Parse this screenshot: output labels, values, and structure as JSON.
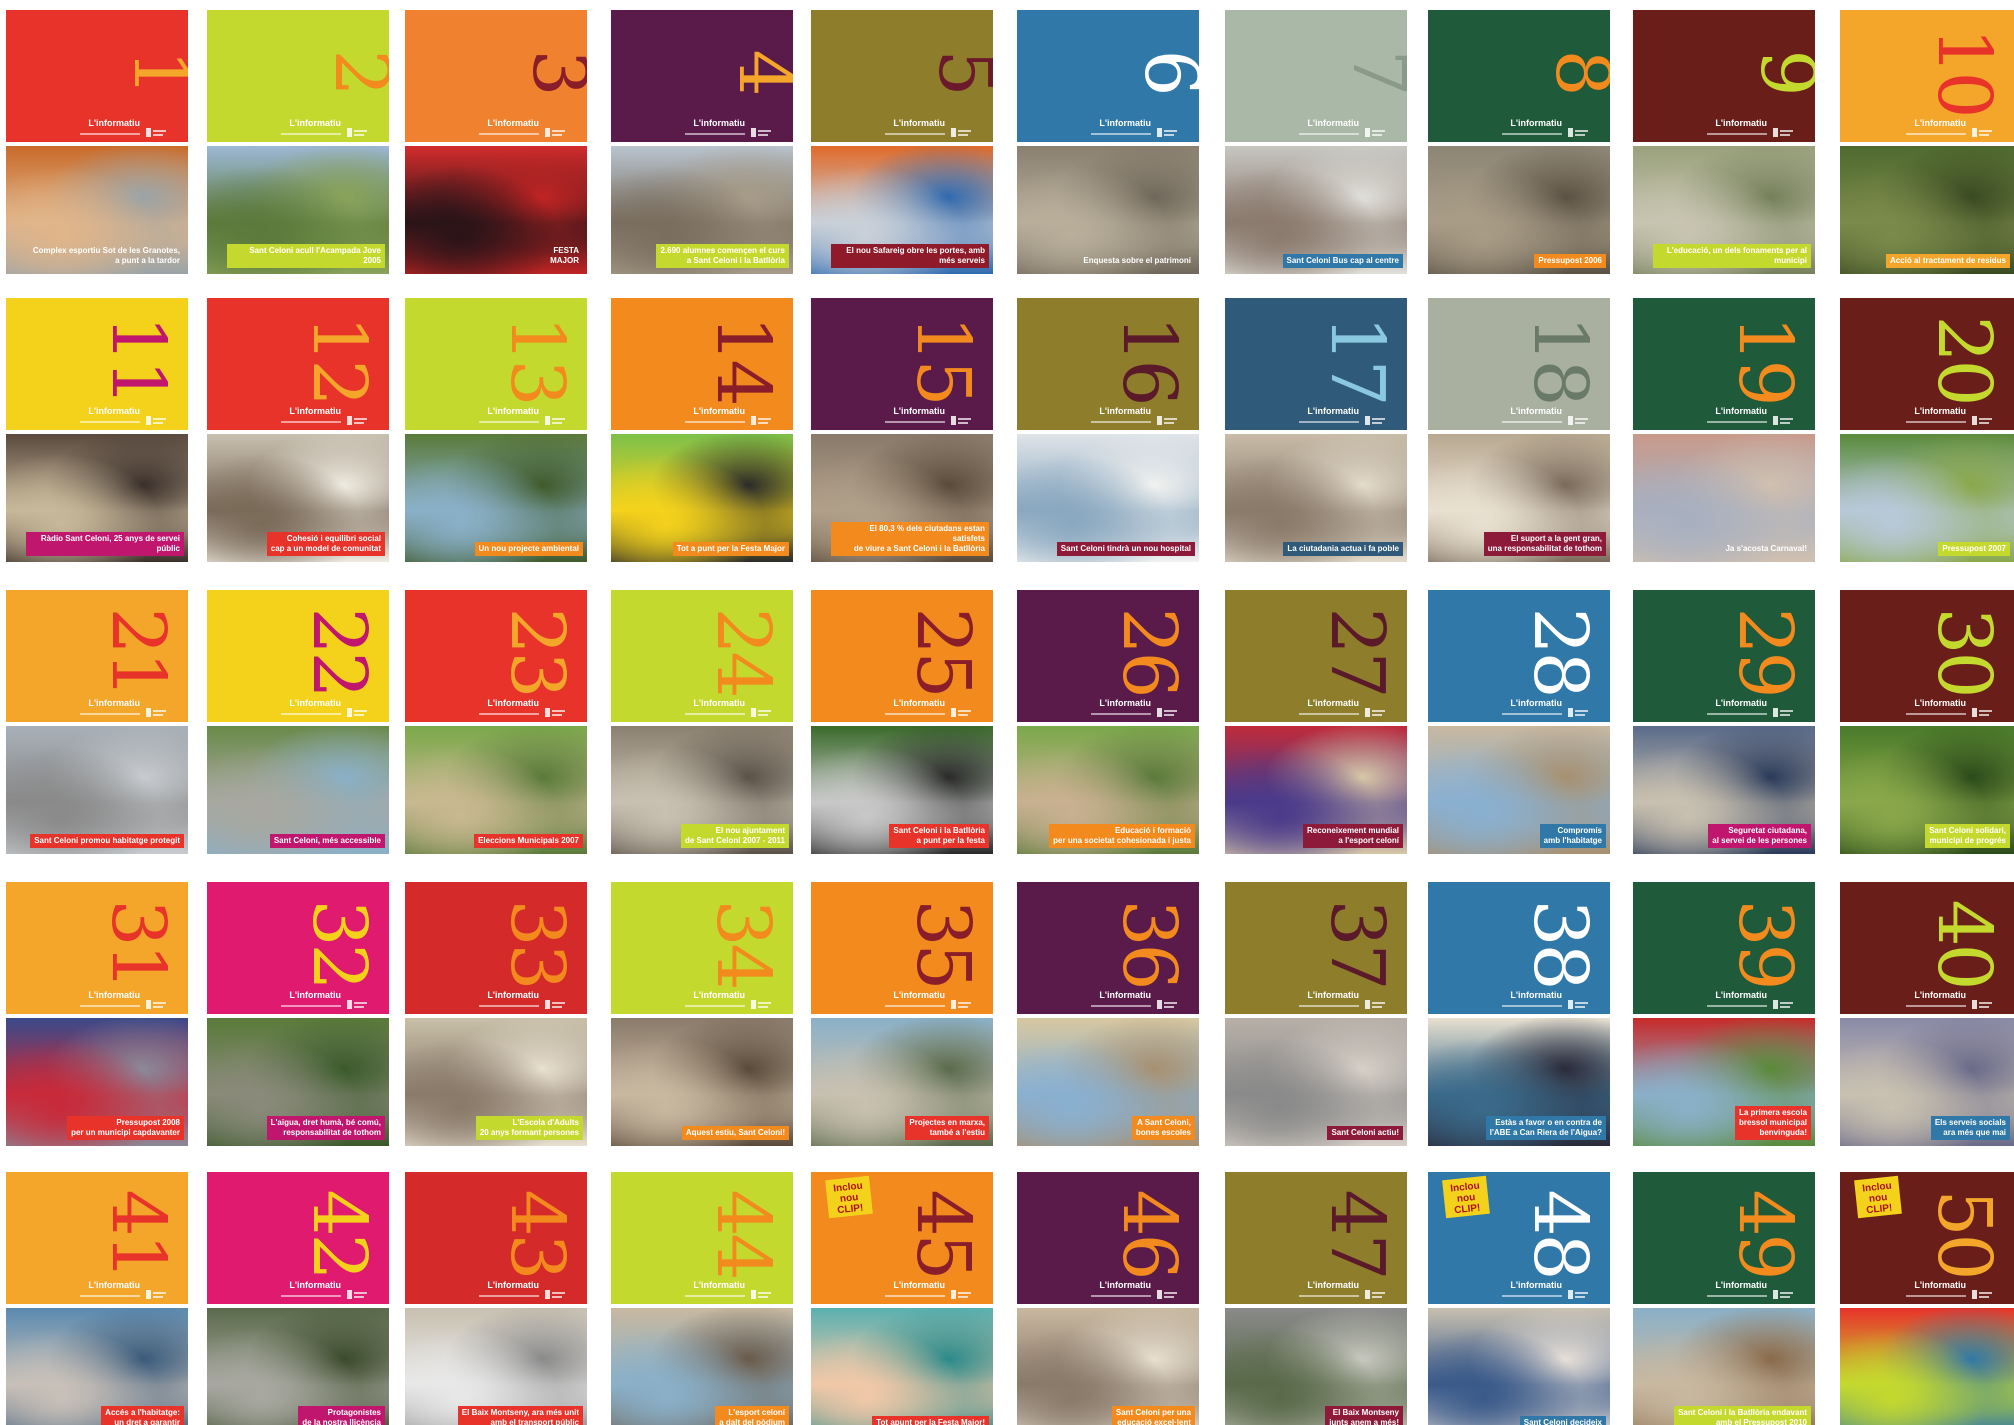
{
  "brand": "L'informatiu",
  "covers": [
    {
      "n": "1",
      "bg": "#e8332b",
      "fg": "#f4a62a",
      "photo": [
        "#c96b2a",
        "#e0b58a",
        "#9aa4a8"
      ],
      "cap": "Complex esportiu Sot de les Granotes,\na punt a la tardor",
      "capbg": "rgba(0,0,0,0)"
    },
    {
      "n": "2",
      "bg": "#c4d92e",
      "fg": "#f28a1e",
      "photo": [
        "#9db8d6",
        "#5b7a3b",
        "#8aa35a"
      ],
      "cap": "Sant Celoni acull l'Acampada Jove 2005",
      "capbg": "#c4d92e"
    },
    {
      "n": "3",
      "bg": "#f0822f",
      "fg": "#8a1d2a",
      "photo": [
        "#d42c2c",
        "#2a1418",
        "#c22424"
      ],
      "cap": "FESTA\nMAJOR",
      "capbg": "rgba(0,0,0,0)"
    },
    {
      "n": "4",
      "bg": "#5a1a4a",
      "fg": "#f4a62a",
      "photo": [
        "#b9c4cf",
        "#7a6e5f",
        "#a89c88"
      ],
      "cap": "2.690 alumnes començen el curs\na Sant Celoni i la Batllòria",
      "capbg": "#c4d92e"
    },
    {
      "n": "5",
      "bg": "#8e7d2a",
      "fg": "#6a1a2a",
      "photo": [
        "#e06a2a",
        "#c9d0d8",
        "#2f6ab0"
      ],
      "cap": "El nou Safareig obre les portes, amb més serveis",
      "capbg": "#8e1a2a"
    },
    {
      "n": "6",
      "bg": "#2f78a8",
      "fg": "#ffffff",
      "photo": [
        "#8a8070",
        "#b8ae9a",
        "#6f675a"
      ],
      "cap": "Enquesta sobre el patrimoni",
      "capbg": "rgba(0,0,0,0)"
    },
    {
      "n": "7",
      "bg": "#aab8a8",
      "fg": "#8a9a88",
      "photo": [
        "#c7c7c2",
        "#8b7a6e",
        "#e0e0da"
      ],
      "cap": "Sant Celoni Bus cap al centre",
      "capbg": "#2f78a8"
    },
    {
      "n": "8",
      "bg": "#1f5a3a",
      "fg": "#f28a1e",
      "photo": [
        "#8d8675",
        "#a89c86",
        "#5b5244"
      ],
      "cap": "Pressupost 2006",
      "capbg": "#f28a1e"
    },
    {
      "n": "9",
      "bg": "#6a1e1a",
      "fg": "#c4d92e",
      "photo": [
        "#9aa17c",
        "#c7c4b0",
        "#75805a"
      ],
      "cap": "L'educació, un dels fonaments per al municipi",
      "capbg": "#c4d92e"
    },
    {
      "n": "10",
      "bg": "#f4a62a",
      "fg": "#e8332b",
      "photo": [
        "#4f6a2f",
        "#7a8a4a",
        "#3a4a22"
      ],
      "cap": "Acció al tractament de residus",
      "capbg": "#f4a62a"
    },
    {
      "n": "11",
      "bg": "#f4d21c",
      "fg": "#c0166e",
      "photo": [
        "#5a4a3f",
        "#c8b89a",
        "#3a2f2a"
      ],
      "cap": "Ràdio Sant Celoni, 25 anys de servei públic",
      "capbg": "#c0166e"
    },
    {
      "n": "12",
      "bg": "#e8332b",
      "fg": "#f4a62a",
      "photo": [
        "#c8c0b0",
        "#7a6a58",
        "#f0ece2"
      ],
      "cap": "Cohesió i equilibri social\ncap a un model de comunitat",
      "capbg": "#e8332b"
    },
    {
      "n": "13",
      "bg": "#c4d92e",
      "fg": "#f28a1e",
      "photo": [
        "#5a7a3a",
        "#8ab0c8",
        "#3f5a2a"
      ],
      "cap": "Un nou projecte ambiental",
      "capbg": "#f28a1e"
    },
    {
      "n": "14",
      "bg": "#f28a1e",
      "fg": "#8a1d2a",
      "photo": [
        "#7cc04a",
        "#f4d21c",
        "#2a2a2a"
      ],
      "cap": "Tot a punt per la Festa Major",
      "capbg": "#f28a1e"
    },
    {
      "n": "15",
      "bg": "#5a1a4a",
      "fg": "#f28a1e",
      "photo": [
        "#8a7a6a",
        "#b0a08a",
        "#5a4a3a"
      ],
      "cap": "El 80,3 % dels ciutadans estan satisfets\nde viure a Sant Celoni i la Batllòria",
      "capbg": "#f28a1e"
    },
    {
      "n": "16",
      "bg": "#8e7d2a",
      "fg": "#5a1a2a",
      "photo": [
        "#dfe4e8",
        "#8aa8c0",
        "#f2f2f0"
      ],
      "cap": "Sant Celoni tindrà un nou hospital",
      "capbg": "#8e1a3a"
    },
    {
      "n": "17",
      "bg": "#2f5a7a",
      "fg": "#8ac8e0",
      "photo": [
        "#c8bca8",
        "#8a7a6a",
        "#e4dccc"
      ],
      "cap": "La ciutadania actua i fa poble",
      "capbg": "#2f5a7a"
    },
    {
      "n": "18",
      "bg": "#aab0a0",
      "fg": "#6a7a68",
      "photo": [
        "#b8a890",
        "#e8e0d0",
        "#7a6a5a"
      ],
      "cap": "El suport a la gent gran,\nuna responsabilitat de tothom",
      "capbg": "#8e1a3a"
    },
    {
      "n": "19",
      "bg": "#1f5a3a",
      "fg": "#f28a1e",
      "photo": [
        "#c89a8a",
        "#a8b0c0",
        "#d0c0b0"
      ],
      "cap": "Ja s'acosta Carnaval!",
      "capbg": "rgba(0,0,0,0)"
    },
    {
      "n": "20",
      "bg": "#6a1e1a",
      "fg": "#c4d92e",
      "photo": [
        "#5a8a3a",
        "#b8c8d8",
        "#8aa84a"
      ],
      "cap": "Pressupost 2007",
      "capbg": "#c4d92e"
    },
    {
      "n": "21",
      "bg": "#f4a62a",
      "fg": "#e8332b",
      "photo": [
        "#a8b0b8",
        "#8a8a8a",
        "#c8ccd0"
      ],
      "cap": "Sant Celoni promou habitatge protegit",
      "capbg": "#e8332b"
    },
    {
      "n": "22",
      "bg": "#f4d21c",
      "fg": "#c0166e",
      "photo": [
        "#6a8a4a",
        "#a8a8a0",
        "#8ab0c8"
      ],
      "cap": "Sant Celoni, més accessible",
      "capbg": "#c0166e"
    },
    {
      "n": "23",
      "bg": "#e8332b",
      "fg": "#f4a62a",
      "photo": [
        "#7aa84a",
        "#c8b890",
        "#5a7a3a"
      ],
      "cap": "Eleccions Municipals 2007",
      "capbg": "#e8332b"
    },
    {
      "n": "24",
      "bg": "#c4d92e",
      "fg": "#f28a1e",
      "photo": [
        "#8a8070",
        "#c8c0b0",
        "#5a5248"
      ],
      "cap": "El nou ajuntament\nde Sant Celoni 2007 - 2011",
      "capbg": "#c4d92e"
    },
    {
      "n": "25",
      "bg": "#f28a1e",
      "fg": "#8a1d2a",
      "photo": [
        "#3a6a2a",
        "#c8c8c8",
        "#2a2a2a"
      ],
      "cap": "Sant Celoni i la Batllòria\na punt per la festa",
      "capbg": "#e8332b"
    },
    {
      "n": "26",
      "bg": "#5a1a4a",
      "fg": "#f28a1e",
      "photo": [
        "#7aa84a",
        "#c8b090",
        "#5a7a3a"
      ],
      "cap": "Educació i formació\nper una societat cohesionada i justa",
      "capbg": "#f28a1e"
    },
    {
      "n": "27",
      "bg": "#8e7d2a",
      "fg": "#5a1a2a",
      "photo": [
        "#c02a3a",
        "#4a3a8a",
        "#d8c8a8"
      ],
      "cap": "Reconeixement mundial\na l'esport celoní",
      "capbg": "#8e1a3a"
    },
    {
      "n": "28",
      "bg": "#2f78a8",
      "fg": "#ffffff",
      "photo": [
        "#c8b8a0",
        "#8ab0d0",
        "#a89070"
      ],
      "cap": "Compromís\namb l'habitatge",
      "capbg": "#2f78a8"
    },
    {
      "n": "29",
      "bg": "#1f5a3a",
      "fg": "#f28a1e",
      "photo": [
        "#5a6a8a",
        "#c8c0b0",
        "#2a3a5a"
      ],
      "cap": "Seguretat ciutadana,\nal servei de les persones",
      "capbg": "#c0166e"
    },
    {
      "n": "30",
      "bg": "#6a1e1a",
      "fg": "#c4d92e",
      "photo": [
        "#4a7a2a",
        "#8aa84a",
        "#2a4a1a"
      ],
      "cap": "Sant Celoni solidari,\nmunicipi de progrés",
      "capbg": "#c4d92e"
    },
    {
      "n": "31",
      "bg": "#f4a62a",
      "fg": "#e8332b",
      "photo": [
        "#3a4a8a",
        "#c82a3a",
        "#8a8a9a"
      ],
      "cap": "Pressupost 2008\nper un municipi capdavanter",
      "capbg": "#e8332b"
    },
    {
      "n": "32",
      "bg": "#e01a6e",
      "fg": "#f4d21c",
      "photo": [
        "#5a7a3a",
        "#8a8a7a",
        "#3a5a2a"
      ],
      "cap": "L'aigua, dret humà, bé comú,\nresponsabilitat de tothom",
      "capbg": "#c0166e"
    },
    {
      "n": "33",
      "bg": "#d42a2a",
      "fg": "#f28a1e",
      "photo": [
        "#c8c0a8",
        "#8a7a6a",
        "#e8e0d0"
      ],
      "cap": "L'Escola d'Adults\n20 anys formant persones",
      "capbg": "#c4d92e"
    },
    {
      "n": "34",
      "bg": "#c4d92e",
      "fg": "#f28a1e",
      "photo": [
        "#8a7a6a",
        "#c8b8a0",
        "#5a4a3a"
      ],
      "cap": "Aquest estiu, Sant Celoni!",
      "capbg": "#f28a1e"
    },
    {
      "n": "35",
      "bg": "#f28a1e",
      "fg": "#8a1d2a",
      "photo": [
        "#8ab0c8",
        "#c8c0b0",
        "#5a6a4a"
      ],
      "cap": "Projectes en marxa,\ntambé a l'estiu",
      "capbg": "#e8332b"
    },
    {
      "n": "36",
      "bg": "#5a1a4a",
      "fg": "#f28a1e",
      "photo": [
        "#d8c8a0",
        "#8ab0d0",
        "#a89070"
      ],
      "cap": "A Sant Celoni,\nbones escoles",
      "capbg": "#f28a1e"
    },
    {
      "n": "37",
      "bg": "#8e7d2a",
      "fg": "#5a1a2a",
      "photo": [
        "#b8b0a8",
        "#8a8a8a",
        "#d8d0c8"
      ],
      "cap": "Sant Celoni actiu!",
      "capbg": "#8e1a3a"
    },
    {
      "n": "38",
      "bg": "#2f78a8",
      "fg": "#ffffff",
      "photo": [
        "#e8e0d0",
        "#3a6a8a",
        "#2a2a3a"
      ],
      "cap": "Estàs a favor o en contra de\nl'ABE a Can Riera de l'Aigua?",
      "capbg": "#2f78a8"
    },
    {
      "n": "39",
      "bg": "#1f5a3a",
      "fg": "#f28a1e",
      "photo": [
        "#c82a2a",
        "#8ab0c8",
        "#5a8a3a"
      ],
      "cap": "La primera escola\nbressol municipal\nbenvinguda!",
      "capbg": "#e8332b"
    },
    {
      "n": "40",
      "bg": "#6a1e1a",
      "fg": "#c4d92e",
      "photo": [
        "#8a8aa8",
        "#c8c0b0",
        "#6a6a8a"
      ],
      "cap": "Els serveis socials\nara més que mai",
      "capbg": "#2f78a8"
    },
    {
      "n": "41",
      "bg": "#f4a62a",
      "fg": "#e8332b",
      "photo": [
        "#5a8ab0",
        "#c8c0b8",
        "#3a5a7a"
      ],
      "cap": "Accés a l'habitatge:\nun dret a garantir",
      "capbg": "#e8332b"
    },
    {
      "n": "42",
      "bg": "#e01a6e",
      "fg": "#f4d21c",
      "photo": [
        "#5a6a4a",
        "#a8a8a0",
        "#3a4a2a"
      ],
      "cap": "Protagonistes\nde la nostra llicència",
      "capbg": "#c0166e"
    },
    {
      "n": "43",
      "bg": "#d42a2a",
      "fg": "#f28a1e",
      "photo": [
        "#c8c0b0",
        "#e8e8e8",
        "#8a8a8a"
      ],
      "cap": "El Baix Montseny, ara més unit\namb el transport públic",
      "capbg": "#e8332b"
    },
    {
      "n": "44",
      "bg": "#c4d92e",
      "fg": "#f28a1e",
      "photo": [
        "#c8b8a0",
        "#8ab0c8",
        "#6a5a4a"
      ],
      "cap": "L'esport celoní\na dalt del pòdium",
      "capbg": "#f28a1e"
    },
    {
      "n": "45",
      "bg": "#f28a1e",
      "fg": "#8a1d2a",
      "photo": [
        "#5ab0b0",
        "#f0c8a8",
        "#2a8a8a"
      ],
      "cap": "Tot apunt per la Festa Major!",
      "capbg": "#e8332b",
      "note": "Inclou\nnou CLIP!"
    },
    {
      "n": "46",
      "bg": "#5a1a4a",
      "fg": "#f28a1e",
      "photo": [
        "#c8b8a0",
        "#8a7a6a",
        "#e8e0d0"
      ],
      "cap": "Sant Celoni per una\neducació excel·lent",
      "capbg": "#f28a1e"
    },
    {
      "n": "47",
      "bg": "#8e7d2a",
      "fg": "#5a1a2a",
      "photo": [
        "#8a8a8a",
        "#5a6a4a",
        "#c8c8c0"
      ],
      "cap": "El Baix Montseny\njunts anem a més!",
      "capbg": "#8e1a3a"
    },
    {
      "n": "48",
      "bg": "#2f78a8",
      "fg": "#ffffff",
      "photo": [
        "#c8c0b0",
        "#3a5a8a",
        "#e8e0d8"
      ],
      "cap": "Sant Celoni decideix",
      "capbg": "#2f78a8",
      "note": "Inclou\nnou CLIP!"
    },
    {
      "n": "49",
      "bg": "#1f5a3a",
      "fg": "#f28a1e",
      "photo": [
        "#8ab0c8",
        "#c8b8a0",
        "#8a6a4a"
      ],
      "cap": "Sant Celoni i la Batllòria endavant\namb el Pressupost 2010",
      "capbg": "#c4d92e"
    },
    {
      "n": "50",
      "bg": "#6a1e1a",
      "fg": "#f4a62a",
      "photo": [
        "#e8332b",
        "#c4d92e",
        "#2f78a8"
      ],
      "cap": "",
      "capbg": "rgba(0,0,0,0)",
      "note": "Inclou\nnou CLIP!"
    }
  ]
}
